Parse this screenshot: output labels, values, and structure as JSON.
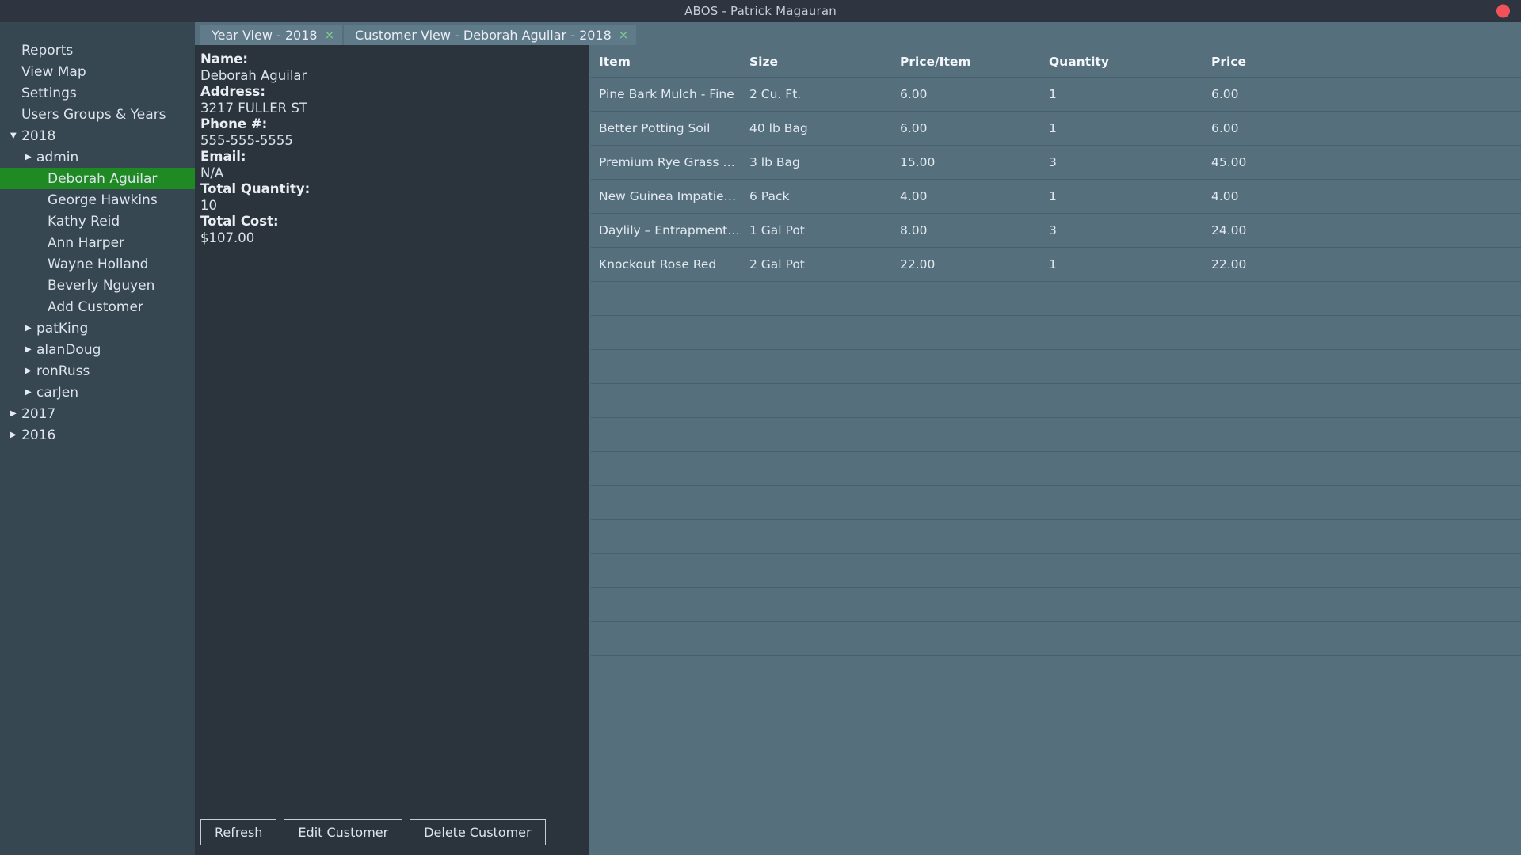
{
  "window": {
    "title": "ABOS - Patrick Magauran",
    "close_icon": "close-circle-icon"
  },
  "sidebar": {
    "nav": [
      {
        "label": "Reports"
      },
      {
        "label": "View Map"
      },
      {
        "label": "Settings"
      },
      {
        "label": "Users Groups & Years"
      }
    ],
    "tree": [
      {
        "label": "2018",
        "level": 1,
        "arrow": "open",
        "selected": false
      },
      {
        "label": "admin",
        "level": 2,
        "arrow": "closed",
        "selected": false
      },
      {
        "label": "Deborah Aguilar",
        "level": 3,
        "arrow": "none",
        "selected": true
      },
      {
        "label": "George Hawkins",
        "level": 3,
        "arrow": "none",
        "selected": false
      },
      {
        "label": "Kathy Reid",
        "level": 3,
        "arrow": "none",
        "selected": false
      },
      {
        "label": "Ann Harper",
        "level": 3,
        "arrow": "none",
        "selected": false
      },
      {
        "label": "Wayne Holland",
        "level": 3,
        "arrow": "none",
        "selected": false
      },
      {
        "label": "Beverly Nguyen",
        "level": 3,
        "arrow": "none",
        "selected": false
      },
      {
        "label": "Add Customer",
        "level": 3,
        "arrow": "none",
        "selected": false
      },
      {
        "label": "patKing",
        "level": 2,
        "arrow": "closed",
        "selected": false
      },
      {
        "label": "alanDoug",
        "level": 2,
        "arrow": "closed",
        "selected": false
      },
      {
        "label": "ronRuss",
        "level": 2,
        "arrow": "closed",
        "selected": false
      },
      {
        "label": "carJen",
        "level": 2,
        "arrow": "closed",
        "selected": false
      },
      {
        "label": "2017",
        "level": 1,
        "arrow": "closed",
        "selected": false
      },
      {
        "label": "2016",
        "level": 1,
        "arrow": "closed",
        "selected": false
      }
    ]
  },
  "tabs": [
    {
      "label": "Year View - 2018",
      "close": "×",
      "active": false
    },
    {
      "label": "Customer View - Deborah Aguilar - 2018",
      "close": "×",
      "active": true
    }
  ],
  "customer_info": [
    {
      "label": "Name:",
      "value": "Deborah Aguilar"
    },
    {
      "label": "Address:",
      "value": "3217 FULLER ST"
    },
    {
      "label": "Phone #:",
      "value": "555-555-5555"
    },
    {
      "label": "Email:",
      "value": "N/A"
    },
    {
      "label": "Total Quantity:",
      "value": "10"
    },
    {
      "label": "Total Cost:",
      "value": "$107.00"
    }
  ],
  "buttons": [
    {
      "label": "Refresh"
    },
    {
      "label": "Edit Customer"
    },
    {
      "label": "Delete Customer"
    }
  ],
  "table": {
    "columns": [
      "Item",
      "Size",
      "Price/Item",
      "Quantity",
      "Price"
    ],
    "rows": [
      [
        "Pine Bark Mulch - Fine",
        "2 Cu. Ft.",
        "6.00",
        "1",
        "6.00"
      ],
      [
        "Better Potting Soil",
        "40 lb Bag",
        "6.00",
        "1",
        "6.00"
      ],
      [
        "Premium Rye Grass Seed",
        "3 lb Bag",
        "15.00",
        "3",
        "45.00"
      ],
      [
        "New Guinea Impatiens Mix",
        "6 Pack",
        "4.00",
        "1",
        "4.00"
      ],
      [
        "Daylily – Entrapment (Lave...",
        "1 Gal Pot",
        "8.00",
        "3",
        "24.00"
      ],
      [
        "Knockout Rose Red",
        "2 Gal Pot",
        "22.00",
        "1",
        "22.00"
      ]
    ],
    "empty_rows": 13
  },
  "colors": {
    "titlebar": "#2e3440",
    "sidebar": "#374752",
    "selection": "#1f8a23",
    "table": "#566f7d",
    "info_panel": "#2b343c",
    "close_button": "#f1525a"
  }
}
